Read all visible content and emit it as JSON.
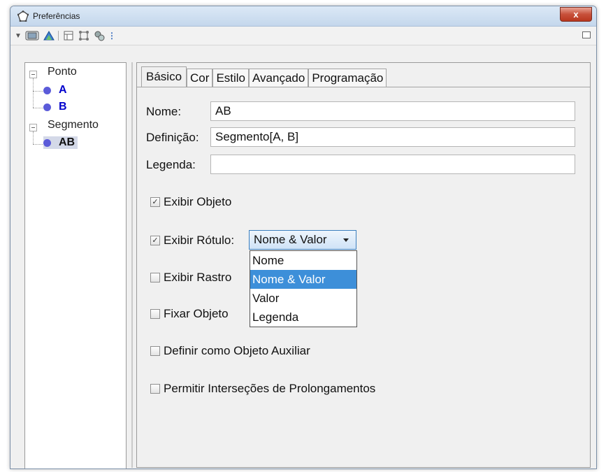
{
  "window": {
    "title": "Preferências",
    "close_label": "x"
  },
  "toolbar": {
    "items": [
      "▼",
      "⊡",
      "▲",
      "|",
      "⊟",
      "⊠",
      "⚙",
      "⋮"
    ]
  },
  "tree": {
    "groups": [
      {
        "label": "Ponto",
        "items": [
          "A",
          "B"
        ]
      },
      {
        "label": "Segmento",
        "items": [
          "AB"
        ]
      }
    ]
  },
  "tabs": [
    "Básico",
    "Cor",
    "Estilo",
    "Avançado",
    "Programação"
  ],
  "form": {
    "name_label": "Nome:",
    "name_value": "AB",
    "definition_label": "Definição:",
    "definition_value": "Segmento[A, B]",
    "caption_label": "Legenda:",
    "caption_value": ""
  },
  "checkboxes": {
    "show_object": "Exibir Objeto",
    "show_label": "Exibir Rótulo:",
    "show_trace": "Exibir Rastro",
    "fix_object": "Fixar Objeto",
    "auxiliary": "Definir como Objeto Auxiliar",
    "extension_intersections": "Permitir Interseções de Prolongamentos"
  },
  "label_combo": {
    "selected": "Nome & Valor",
    "options": [
      "Nome",
      "Nome & Valor",
      "Valor",
      "Legenda"
    ]
  },
  "colors": {
    "accent": "#3d8fd9",
    "point": "#5b5bd9",
    "object_text": "#0000cc"
  }
}
